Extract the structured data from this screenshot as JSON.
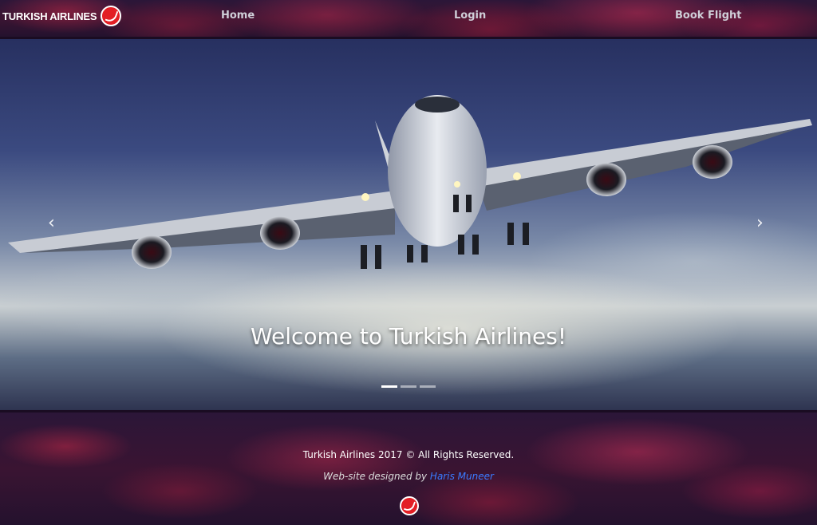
{
  "brand": {
    "name": "TURKISH AIRLINES",
    "logo_icon": "turkish-airlines-bird-icon",
    "color": "#e31e24"
  },
  "nav": {
    "home": "Home",
    "login": "Login",
    "book_flight": "Book Flight"
  },
  "carousel": {
    "caption": "Welcome to Turkish Airlines!",
    "prev_icon": "chevron-left-icon",
    "next_icon": "chevron-right-icon",
    "prev_glyph": "‹",
    "next_glyph": "›",
    "slide_count": 3,
    "active_slide": 1
  },
  "footer": {
    "copyright": "Turkish Airlines 2017 © All Rights Reserved.",
    "designed_by_prefix": "Web-site designed by ",
    "designer": "Haris Muneer",
    "link_color": "#3a7bff"
  }
}
